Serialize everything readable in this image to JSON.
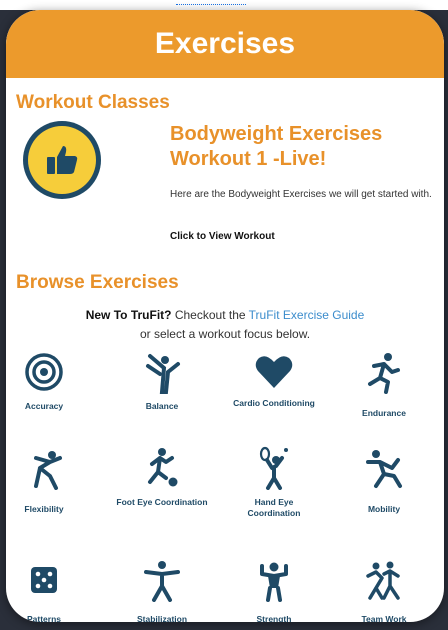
{
  "header": {
    "title": "Exercises"
  },
  "workout_section": {
    "heading": "Workout Classes",
    "class_title_line1": "Bodyweight Exercises",
    "class_title_line2": "Workout 1 -Live!",
    "description": "Here are the Bodyweight Exercises we will get started with.",
    "link": "Click to View Workout"
  },
  "browse_section": {
    "heading": "Browse Exercises",
    "intro_bold": "New To TruFit?",
    "intro_text": " Checkout the ",
    "intro_link": "TruFit Exercise Guide",
    "intro_line2": "or select a workout focus below."
  },
  "categories": [
    {
      "label": "Accuracy",
      "icon": "target-icon"
    },
    {
      "label": "Balance",
      "icon": "balance-icon"
    },
    {
      "label": "Cardio Conditioning",
      "icon": "heart-icon"
    },
    {
      "label": "Endurance",
      "icon": "runner-icon"
    },
    {
      "label": "Flexibility",
      "icon": "stretch-icon"
    },
    {
      "label": "Foot Eye Coordination",
      "icon": "soccer-icon"
    },
    {
      "label": "Hand Eye Coordination",
      "icon": "tennis-icon"
    },
    {
      "label": "Mobility",
      "icon": "mobility-icon"
    },
    {
      "label": "Patterns",
      "icon": "dice-icon"
    },
    {
      "label": "Stabilization",
      "icon": "stabilization-icon"
    },
    {
      "label": "Strength",
      "icon": "strength-icon"
    },
    {
      "label": "Team Work",
      "icon": "team-icon"
    }
  ],
  "colors": {
    "accent": "#ec9a2c",
    "heading": "#e8912a",
    "icon": "#1f4a66",
    "link": "#3b8ccc",
    "badge": "#f6cd3a"
  }
}
